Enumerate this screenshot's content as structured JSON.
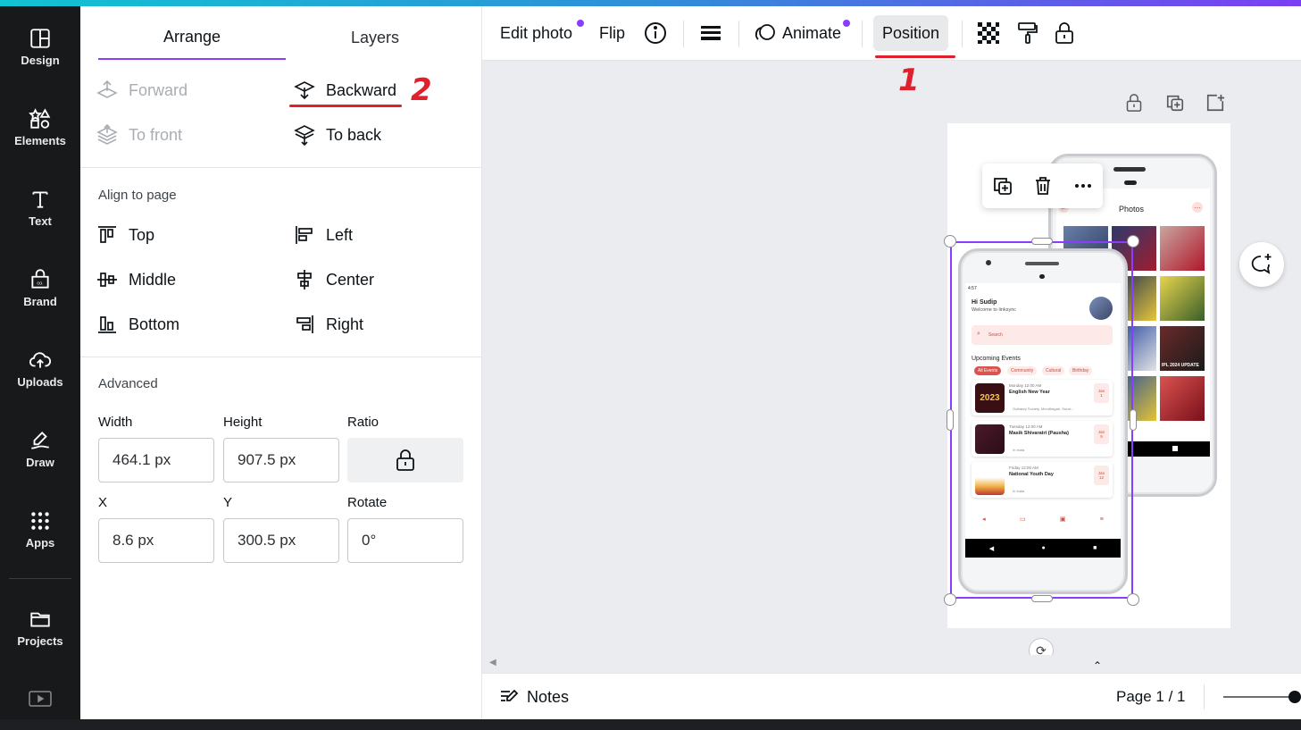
{
  "rail": {
    "items": [
      {
        "label": "Design",
        "icon": "layout-icon"
      },
      {
        "label": "Elements",
        "icon": "shapes-icon"
      },
      {
        "label": "Text",
        "icon": "text-icon"
      },
      {
        "label": "Brand",
        "icon": "brand-icon"
      },
      {
        "label": "Uploads",
        "icon": "cloud-upload-icon"
      },
      {
        "label": "Draw",
        "icon": "pen-icon"
      },
      {
        "label": "Apps",
        "icon": "grid-icon"
      },
      {
        "label": "Projects",
        "icon": "folder-icon"
      }
    ]
  },
  "panel": {
    "tabs": [
      {
        "label": "Arrange"
      },
      {
        "label": "Layers"
      }
    ],
    "order": {
      "forward": "Forward",
      "backward": "Backward",
      "to_front": "To front",
      "to_back": "To back"
    },
    "align_title": "Align to page",
    "align": {
      "top": "Top",
      "left": "Left",
      "middle": "Middle",
      "center": "Center",
      "bottom": "Bottom",
      "right": "Right"
    },
    "advanced_title": "Advanced",
    "fields": {
      "width": {
        "label": "Width",
        "value": "464.1 px"
      },
      "height": {
        "label": "Height",
        "value": "907.5 px"
      },
      "ratio": {
        "label": "Ratio"
      },
      "x": {
        "label": "X",
        "value": "8.6 px"
      },
      "y": {
        "label": "Y",
        "value": "300.5 px"
      },
      "rotate": {
        "label": "Rotate",
        "value": "0°"
      }
    },
    "annotation_backward": "2"
  },
  "toolbar": {
    "edit_photo": "Edit photo",
    "flip": "Flip",
    "animate": "Animate",
    "position": "Position",
    "annotation_position": "1"
  },
  "canvas": {
    "front_phone": {
      "status": "4:57",
      "greeting": "Hi Sudip",
      "welcome": "Welcome to linksync",
      "search": "Search",
      "section": "Upcoming Events",
      "chips": [
        "All Events",
        "Community",
        "Cultural",
        "Birthday"
      ],
      "events": [
        {
          "time": "Monday 12:00 AM",
          "title": "English New Year",
          "place": "Gulfakey Society, Mondhagari, Surat...",
          "month": "Jan",
          "day": "1",
          "thumb": "2023"
        },
        {
          "time": "Tuesday 12:00 AM",
          "title": "Masik Shivaratri (Pausha)",
          "place": "In India",
          "month": "Jan",
          "day": "9",
          "thumb": ""
        },
        {
          "time": "Friday 12:00 AM",
          "title": "National Youth Day",
          "place": "In India",
          "month": "Jan",
          "day": "12",
          "thumb": ""
        }
      ]
    },
    "back_phone": {
      "title": "Photos",
      "badge": "IPL 2024 UPDATE"
    }
  },
  "footer": {
    "notes": "Notes",
    "page": "Page 1 / 1"
  },
  "colors": {
    "accent": "#8b3dff",
    "annotation": "#e0202a",
    "rail": "#18191b"
  }
}
